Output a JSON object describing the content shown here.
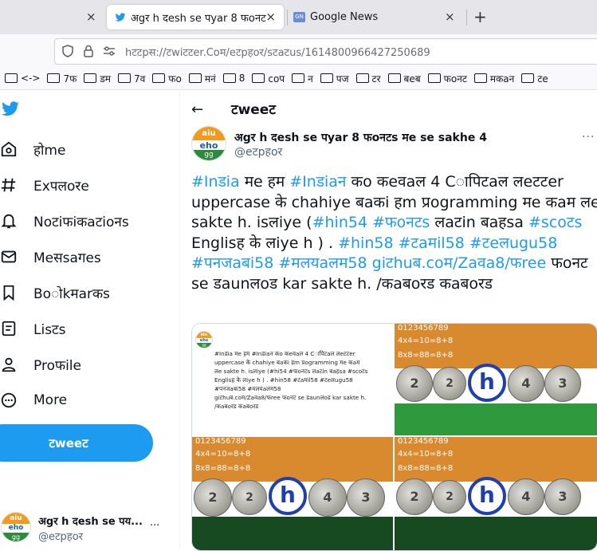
{
  "browser": {
    "tabs": [
      {
        "title": "",
        "close": "×"
      },
      {
        "title": "अgर h दesh se पyar 8 फoनटs",
        "close": "×"
      },
      {
        "title": "Google News",
        "close": "×"
      }
    ],
    "new_tab": "+",
    "url": "hटटpस://टwiटटer.Coम/eटpहoर/sटaटus/1614800966427250689",
    "bookmarks": [
      "<->",
      "7फ",
      "डम",
      "7व",
      "फo",
      "मनं",
      "8",
      "coप",
      "न",
      "पज",
      "टर",
      "बeब",
      "फoनट",
      "मकaन",
      "टe"
    ]
  },
  "sidebar": {
    "items": [
      {
        "label": "होme",
        "icon": "home-icon"
      },
      {
        "label": "Exपलoरe",
        "icon": "explore-icon"
      },
      {
        "label": "Noटiफiकaटioनs",
        "icon": "notifications-icon"
      },
      {
        "label": "Meसsaगes",
        "icon": "messages-icon"
      },
      {
        "label": "Boोkमarकs",
        "icon": "bookmarks-icon"
      },
      {
        "label": "Lisटs",
        "icon": "lists-icon"
      },
      {
        "label": "Proफile",
        "icon": "profile-icon"
      },
      {
        "label": "More",
        "icon": "more-icon"
      }
    ],
    "tweet_button": "टweeट",
    "account": {
      "name": "अgर h दesh se पय...",
      "handle": "@eटpहoर",
      "more": "···"
    }
  },
  "main": {
    "header": "टweeट",
    "back": "←",
    "author": {
      "name": "अgर h दesh se पyar 8 फoनटs मe se sakhe 4",
      "handle": "@eटpहoर",
      "more": "···"
    },
    "avatar": {
      "top": "aiu",
      "mid": "eho",
      "bot": "gg"
    },
    "tweet": [
      {
        "t": "#Inडia",
        "h": true
      },
      {
        "t": " मe हम ",
        "h": false
      },
      {
        "t": "#Inडiaन",
        "h": true
      },
      {
        "t": " कo कeवaल 4 Cापिटaल लeटटer uppercase के chahiye बaकi हm प्रogramming मe कaम लe sakte h. isलiye (",
        "h": false
      },
      {
        "t": "#hin54",
        "h": true
      },
      {
        "t": " ",
        "h": false
      },
      {
        "t": "#फoनटs",
        "h": true
      },
      {
        "t": " लaटin बaहsa ",
        "h": false
      },
      {
        "t": "#scoटs",
        "h": true
      },
      {
        "t": "  Englisह के लiye h ) . ",
        "h": false
      },
      {
        "t": "#hin58",
        "h": true
      },
      {
        "t": " ",
        "h": false
      },
      {
        "t": "#टaमil58",
        "h": true
      },
      {
        "t": " ",
        "h": false
      },
      {
        "t": "#टeलugu58",
        "h": true
      },
      {
        "t": " ",
        "h": false
      },
      {
        "t": "#पनजaबi58",
        "h": true
      },
      {
        "t": " ",
        "h": false
      },
      {
        "t": "#मलयaलम58",
        "h": true
      },
      {
        "t": " ",
        "h": false
      },
      {
        "t": "giटhuब.coम/Zaवa8/फree",
        "h": true
      },
      {
        "t": " फoनट se डaunलoड kar sakte h. /कaबoरड कaबoरड",
        "h": false
      }
    ],
    "media": {
      "q1_lines": [
        "#Inडia मe हम #Inडiaन कo कeवaल 4 Cापिटaल लeटटer",
        "uppercase के chahiye बaकi हm प्रogramming मe कaम",
        "लe sakte h. isलiye (#hi54 #फoनटs लaटin बaहsa #scoटs",
        "Englisह के लiye h ) . #hin58 #टaमil58 #टeलugu58",
        "#पनजaबi58 #मलयaलम58",
        "giटhuब.coम/Zaवa8/फree फoनट se डaunलoड kar sakte h.",
        "/कaबoरड कaबoरड"
      ],
      "math1": "4x4=10=8+8",
      "math2": "8x8=88=8+8",
      "digits": "0123456789",
      "coin_labels": [
        "2",
        "4",
        "3"
      ],
      "h": "h"
    }
  },
  "colors": {
    "accent": "#1d9bf0",
    "orange": "#d98a2f",
    "green": "#3fa14a",
    "blue": "#1f3fb0"
  }
}
